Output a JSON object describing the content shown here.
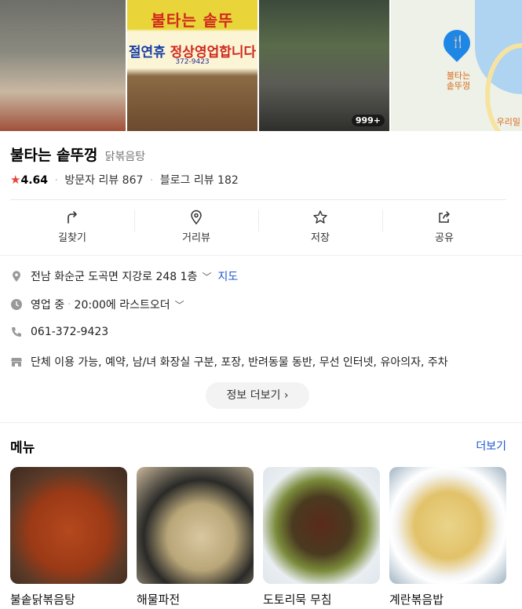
{
  "photos": {
    "sign_top": "불타는 솥뚜",
    "sign_main_blue": "절연휴",
    "sign_main_red": "정상영업",
    "sign_main_tail": "합니다",
    "sign_phone": "372-9423",
    "photo_count": "999+",
    "map_label": "불타는\n솥뚜껑",
    "map_label2": "우리밀"
  },
  "place": {
    "name": "불타는 솥뚜껑",
    "category": "닭볶음탕",
    "rating": "4.64",
    "visitor_reviews": "방문자 리뷰 867",
    "blog_reviews": "블로그 리뷰 182"
  },
  "actions": [
    {
      "label": "길찾기",
      "icon": "directions-icon"
    },
    {
      "label": "거리뷰",
      "icon": "location-pin-icon"
    },
    {
      "label": "저장",
      "icon": "star-icon"
    },
    {
      "label": "공유",
      "icon": "share-icon"
    }
  ],
  "info": {
    "address": "전남 화순군 도곡면 지강로 248 1층",
    "map_link": "지도",
    "hours_status": "영업 중",
    "hours_detail": "20:00에 라스트오더",
    "phone": "061-372-9423",
    "amenities": "단체 이용 가능, 예약, 남/녀 화장실 구분, 포장, 반려동물 동반, 무선 인터넷, 유아의자, 주차",
    "more_info": "정보 더보기"
  },
  "menu": {
    "title": "메뉴",
    "more": "더보기",
    "items": [
      {
        "name": "불솥닭볶음탕"
      },
      {
        "name": "해물파전"
      },
      {
        "name": "도토리묵 무침"
      },
      {
        "name": "계란볶음밥"
      }
    ]
  },
  "colors": {
    "accent_blue": "#1a55d6",
    "star_red": "#e8433b",
    "map_pin": "#1e87e6"
  }
}
